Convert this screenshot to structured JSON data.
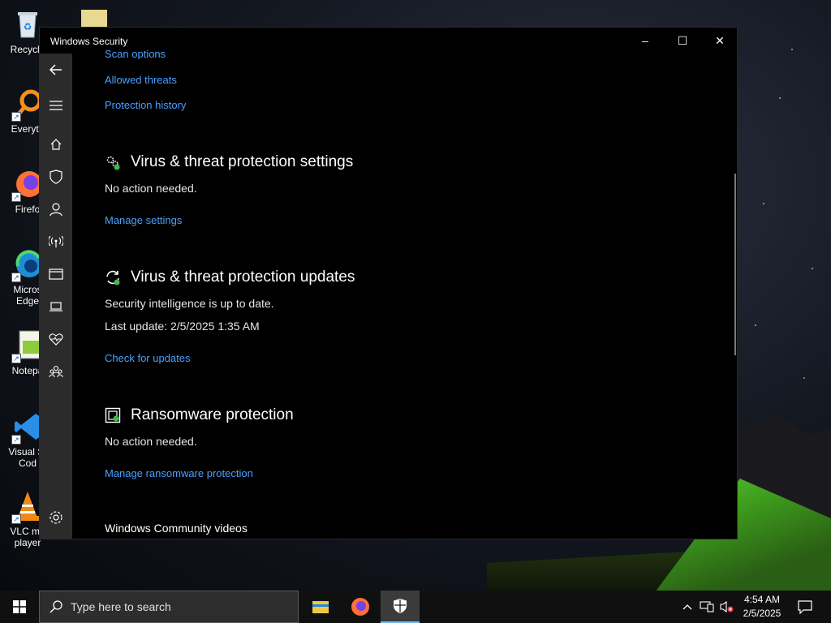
{
  "desktop": {
    "icons": [
      {
        "label": "Recycle",
        "icon": "recycle-bin-icon"
      },
      {
        "label": "Everyth",
        "icon": "everything-search-icon"
      },
      {
        "label": "Firefo",
        "icon": "firefox-icon"
      },
      {
        "label": "Micros\nEdge",
        "label_line1": "Micros",
        "label_line2": "Edge",
        "icon": "edge-icon"
      },
      {
        "label": "Notepa",
        "icon": "notepad-icon"
      },
      {
        "label_line1": "Visual St",
        "label_line2": "Cod",
        "icon": "vscode-icon"
      },
      {
        "label_line1": "VLC me",
        "label_line2": "player",
        "icon": "vlc-icon"
      }
    ]
  },
  "window": {
    "title": "Windows Security",
    "controls": {
      "minimize": "–",
      "maximize": "☐",
      "close": "✕"
    }
  },
  "sidebar": {
    "items": [
      "back-icon",
      "menu-icon",
      "home-icon",
      "shield-icon",
      "account-icon",
      "network-icon",
      "app-browser-icon",
      "device-security-icon",
      "health-icon",
      "family-icon",
      "settings-icon"
    ]
  },
  "content": {
    "links_top": {
      "scan_options": "Scan options",
      "allowed_threats": "Allowed threats",
      "protection_history": "Protection history"
    },
    "settings_section": {
      "heading": "Virus & threat protection settings",
      "status": "No action needed.",
      "link": "Manage settings"
    },
    "updates_section": {
      "heading": "Virus & threat protection updates",
      "status": "Security intelligence is up to date.",
      "last_update": "Last update: 2/5/2025 1:35 AM",
      "link": "Check for updates"
    },
    "ransomware_section": {
      "heading": "Ransomware protection",
      "status": "No action needed.",
      "link": "Manage ransomware protection"
    },
    "community_heading": "Windows Community videos"
  },
  "taskbar": {
    "search_placeholder": "Type here to search",
    "clock_time": "4:54 AM",
    "clock_date": "2/5/2025"
  },
  "colors": {
    "link": "#4aa0ff",
    "sidebar": "#2b2b2b",
    "ok_green": "#3fb950"
  }
}
